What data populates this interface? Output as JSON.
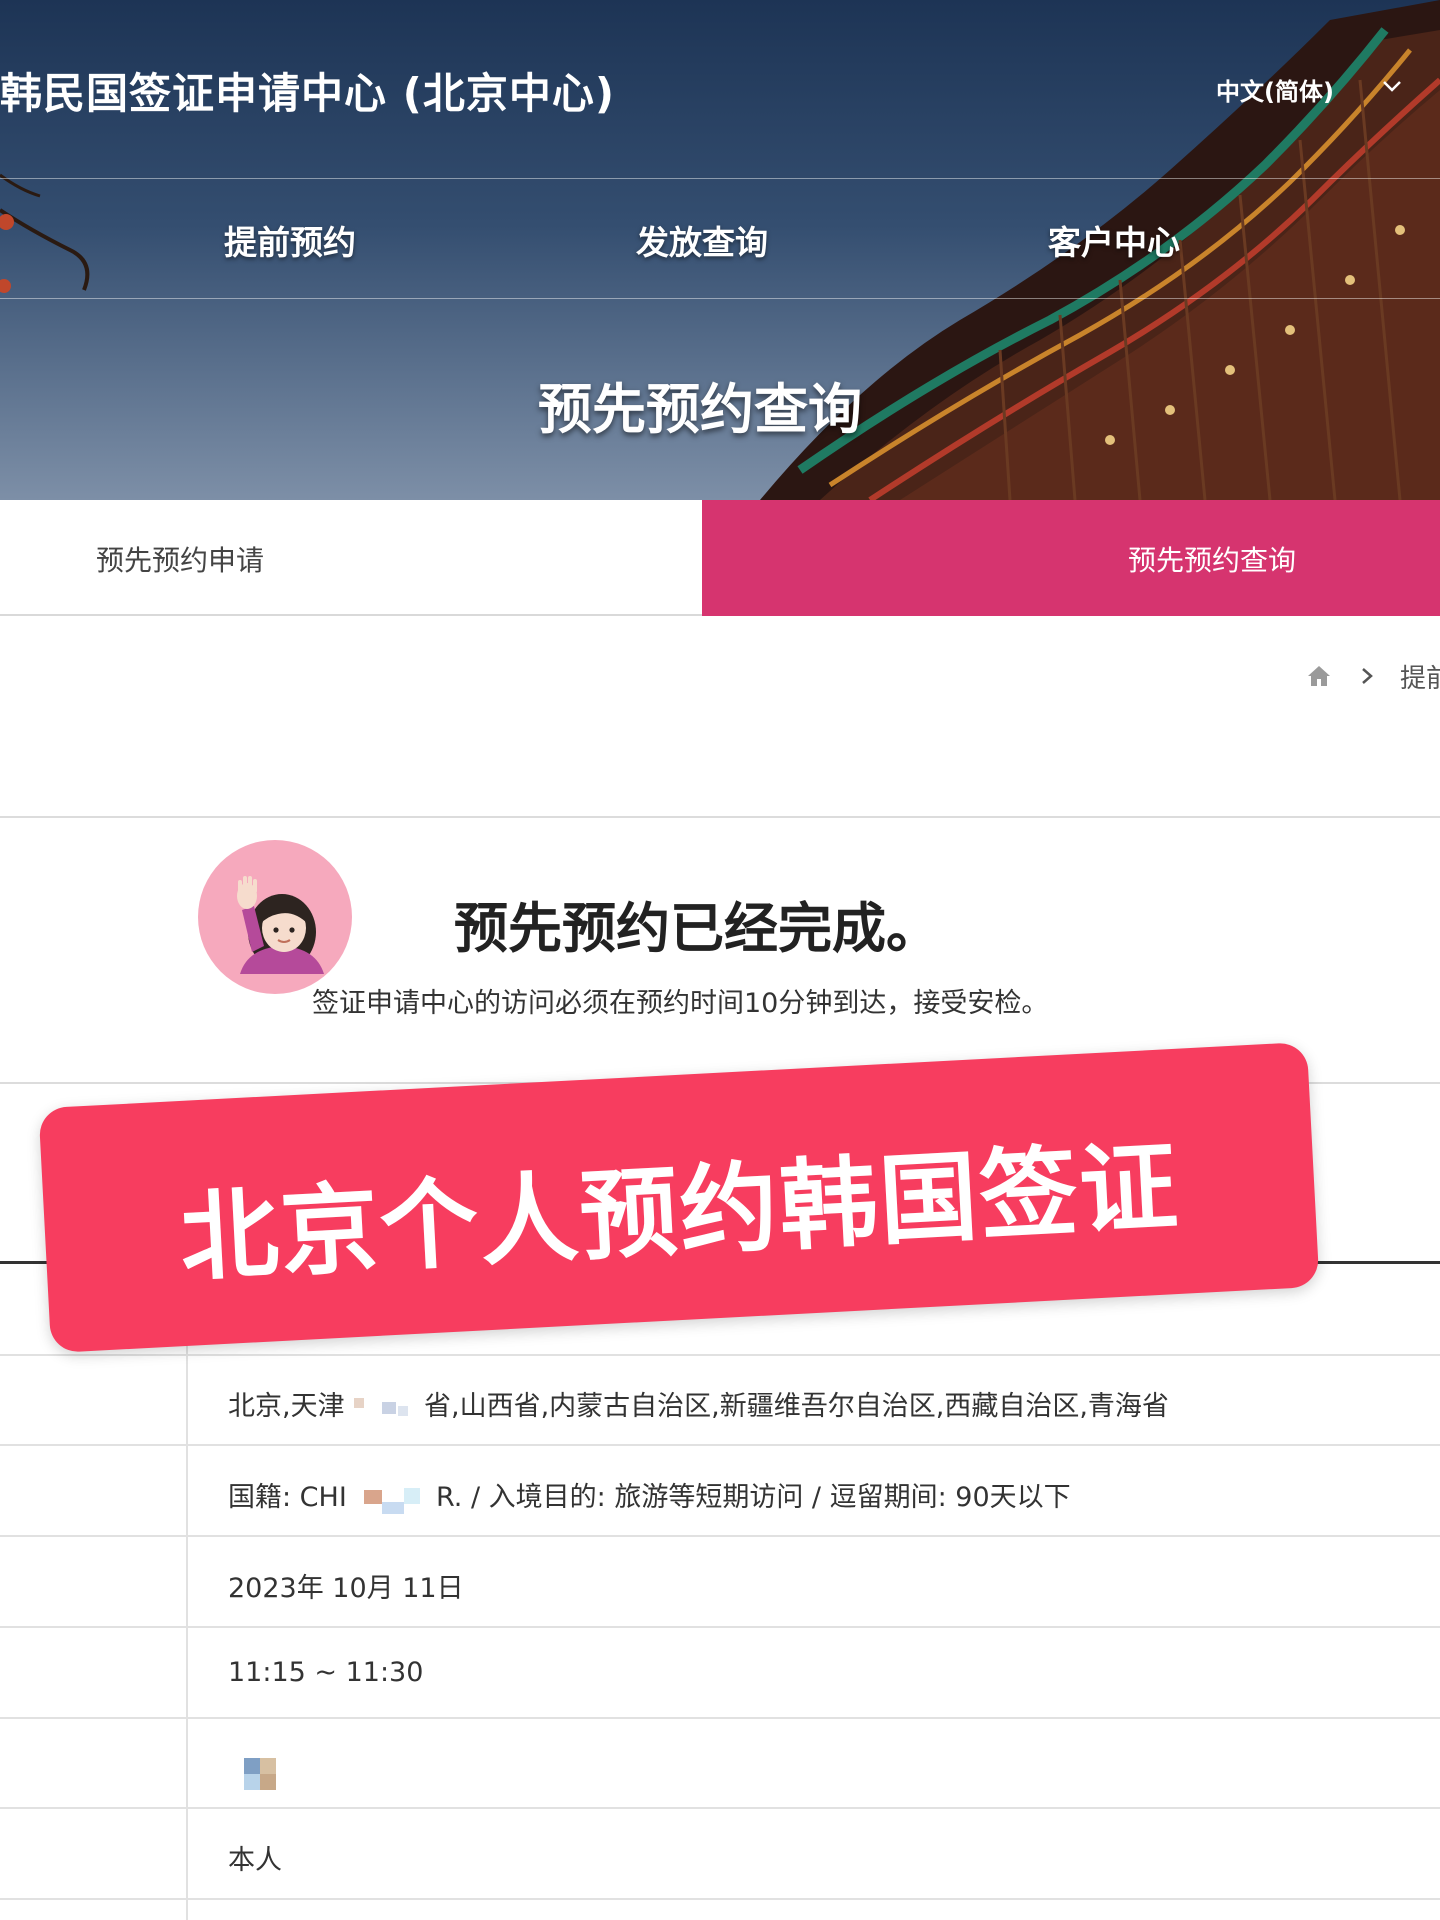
{
  "header": {
    "site_title": "韩民国签证申请中心 (北京中心)",
    "language": "中文(简体)",
    "nav": [
      "提前预约",
      "发放查询",
      "客户中心"
    ],
    "hero_heading": "预先预约查询"
  },
  "tabs": {
    "apply_label": "预先预约申请",
    "query_label": "预先预约查询",
    "active_color": "#d6346f"
  },
  "breadcrumb": {
    "current_prefix": "提前"
  },
  "result": {
    "title": "预先预约已经完成。",
    "note": "签证申请中心的访问必须在预约时间10分钟到达，接受安检。"
  },
  "details": {
    "region": "北京,天津",
    "region_tail": "省,山西省,内蒙古自治区,新疆维吾尔自治区,西藏自治区,青海省",
    "category_prefix": "国籍: CHI",
    "category_tail": "R. / 入境目的: 旅游等短期访问 / 逗留期间: 90天以下",
    "date": "2023年 10月 11日",
    "time": "11:15 ~ 11:30",
    "applicant": "本人"
  },
  "overlay": {
    "banner_text": "北京个人预约韩国签证",
    "banner_color": "#f73d5f"
  },
  "icons": [
    "raising-hand-woman-icon",
    "home-icon",
    "chevron-right-icon",
    "chevron-down-icon"
  ]
}
